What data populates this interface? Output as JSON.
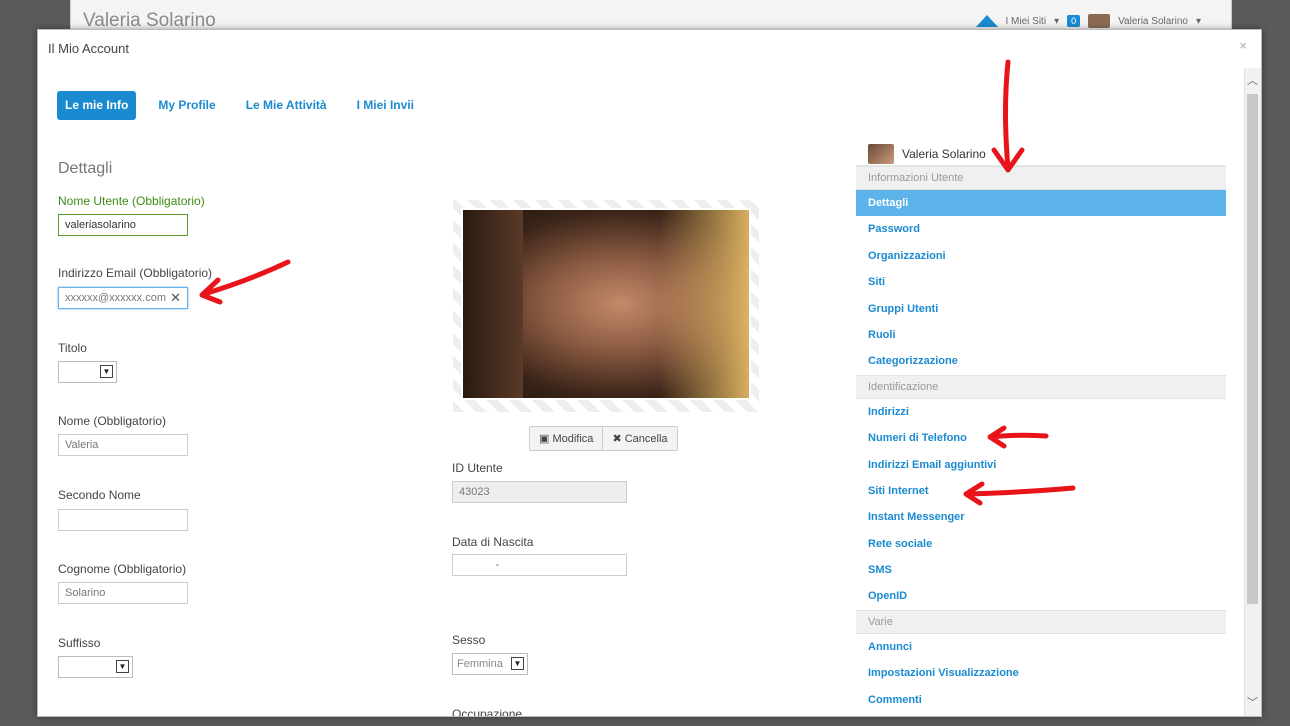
{
  "background": {
    "title": "Valeria Solarino",
    "my_sites": "I Miei Siti",
    "badge": "0",
    "user": "Valeria Solarino"
  },
  "modal": {
    "title": "Il Mio Account",
    "close": "×"
  },
  "tabs": [
    {
      "label": "Le mie Info",
      "active": true
    },
    {
      "label": "My Profile"
    },
    {
      "label": "Le Mie Attività"
    },
    {
      "label": "I Miei Invii"
    }
  ],
  "section_title": "Dettagli",
  "form": {
    "username_label": "Nome Utente (Obbligatorio)",
    "username_value": "valeriasolarino",
    "email_label": "Indirizzo Email (Obbligatorio)",
    "email_value": "xxxxxx@xxxxxx.com",
    "title_label": "Titolo",
    "first_name_label": "Nome (Obbligatorio)",
    "first_name_value": "Valeria",
    "middle_name_label": "Secondo Nome",
    "last_name_label": "Cognome (Obbligatorio)",
    "last_name_value": "Solarino",
    "suffix_label": "Suffisso",
    "user_id_label": "ID Utente",
    "user_id_value": "43023",
    "birth_label": "Data di Nascita",
    "birth_value": "-",
    "gender_label": "Sesso",
    "gender_value": "Femmina",
    "job_label": "Occupazione"
  },
  "photo": {
    "edit_label": "Modifica",
    "delete_label": "Cancella"
  },
  "nav": {
    "user": "Valeria Solarino",
    "groups": [
      {
        "title": "Informazioni Utente",
        "items": [
          "Dettagli",
          "Password",
          "Organizzazioni",
          "Siti",
          "Gruppi Utenti",
          "Ruoli",
          "Categorizzazione"
        ]
      },
      {
        "title": "Identificazione",
        "items": [
          "Indirizzi",
          "Numeri di Telefono",
          "Indirizzi Email aggiuntivi",
          "Siti Internet",
          "Instant Messenger",
          "Rete sociale",
          "SMS",
          "OpenID"
        ]
      },
      {
        "title": "Varie",
        "items": [
          "Annunci",
          "Impostazioni Visualizzazione",
          "Commenti"
        ]
      }
    ],
    "active_item": "Dettagli"
  },
  "colors": {
    "accent": "#1a8bd0",
    "required_label": "#3f8b15",
    "active_nav": "#5bb3e9",
    "annotation": "#e8141a"
  }
}
